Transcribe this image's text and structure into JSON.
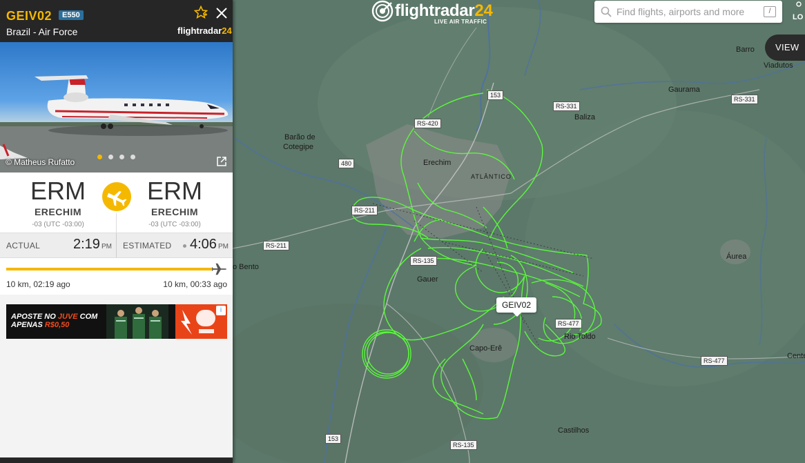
{
  "header": {
    "logo_word": "flightradar24",
    "logo_tagline": "LIVE AIR TRAFFIC",
    "search_placeholder": "Find flights, airports and more",
    "search_shortcut": "/",
    "login_label": "LO",
    "view_button": "VIEW"
  },
  "flight": {
    "callsign": "GEIV02",
    "aircraft_type": "E550",
    "operator": "Brazil - Air Force",
    "panel_logo": "flightradar24",
    "photo_credit": "© Matheus Rufatto",
    "photo_count": 4,
    "photo_active_index": 0,
    "origin": {
      "code": "ERM",
      "name": "ERECHIM",
      "tz": "-03 (UTC -03:00)"
    },
    "destination": {
      "code": "ERM",
      "name": "ERECHIM",
      "tz": "-03 (UTC -03:00)"
    },
    "actual_label": "ACTUAL",
    "actual_time": "2:19",
    "actual_ampm": "PM",
    "estimated_label": "ESTIMATED",
    "estimated_time": "4:06",
    "estimated_ampm": "PM",
    "progress_fraction": 0.98,
    "distance_left": "10 km, 02:19 ago",
    "distance_right": "10 km, 00:33 ago",
    "map_label": "GEIV02"
  },
  "ad": {
    "line1": "APOSTE NO",
    "line1_highlight": "JUVE",
    "line1_end": "COM",
    "line2": "APENAS",
    "line2_highlight": "R$0,50",
    "info": "i"
  },
  "map": {
    "places": [
      {
        "name": "Barro"
      },
      {
        "name": "Viadutos"
      },
      {
        "name": "Gaurama"
      },
      {
        "name": "Baliza"
      },
      {
        "name": "Barão de"
      },
      {
        "name": "Cotegipe"
      },
      {
        "name": "Erechim"
      },
      {
        "name": "ATLÂNTICO"
      },
      {
        "name": "Áurea"
      },
      {
        "name": "o Bento"
      },
      {
        "name": "Gauer"
      },
      {
        "name": "Rio Toldo"
      },
      {
        "name": "Capo-Erê"
      },
      {
        "name": "Castilhos"
      },
      {
        "name": "Cente"
      }
    ],
    "roads": [
      "153",
      "RS-331",
      "RS-331",
      "RS-420",
      "480",
      "RS-211",
      "RS-211",
      "RS-135",
      "RS-477",
      "RS-135",
      "153",
      "RS-477"
    ]
  },
  "colors": {
    "accent": "#f5b800",
    "track": "#5aff3a",
    "panel_header": "#262626",
    "badge": "#2b6f9c"
  }
}
